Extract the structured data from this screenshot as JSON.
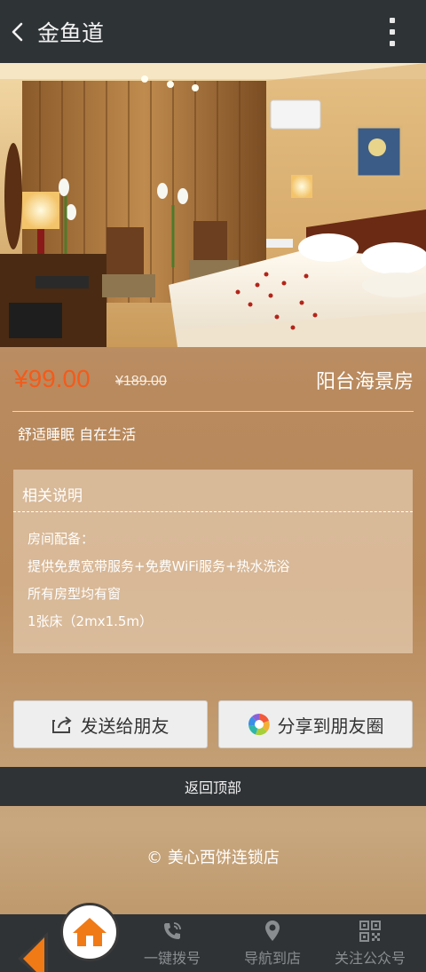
{
  "header": {
    "title": "金鱼道"
  },
  "room": {
    "price": "¥99.00",
    "old_price": "¥189.00",
    "name": "阳台海景房",
    "slogan": "舒适睡眠 自在生活"
  },
  "info": {
    "title": "相关说明",
    "lines": [
      "房间配备：",
      "提供免费宽带服务+免费WiFi服务+热水洗浴",
      "所有房型均有窗",
      "1张床（2mx1.5m）"
    ]
  },
  "actions": {
    "send_label": "发送给朋友",
    "share_label": "分享到朋友圈"
  },
  "footer": {
    "back_top": "返回顶部",
    "copyright": "© 美心西饼连锁店"
  },
  "bottom_nav": {
    "dial": "一键拨号",
    "navigate": "导航到店",
    "follow": "关注公众号"
  },
  "colors": {
    "accent": "#f35b1b",
    "header_bg": "#2e3336",
    "home_orange": "#f07a16"
  }
}
